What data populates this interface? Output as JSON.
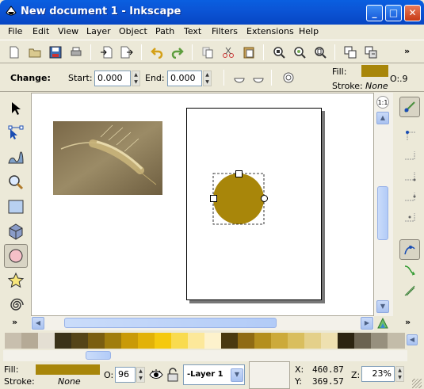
{
  "window": {
    "title": "New document 1 - Inkscape",
    "buttons": [
      "_",
      "□",
      "✕"
    ]
  },
  "menu": [
    "File",
    "Edit",
    "View",
    "Layer",
    "Object",
    "Path",
    "Text",
    "Filters",
    "Extensions",
    "Help"
  ],
  "toolbar": {
    "overflow": "»"
  },
  "controls": {
    "label": "Change:",
    "start_label": "Start:",
    "start_value": "0.000",
    "end_label": "End:",
    "end_value": "0.000"
  },
  "style_indicator": {
    "fill_label": "Fill:",
    "fill_color": "#A8860A",
    "opacity_label": "O:",
    "opacity_value": ".9",
    "stroke_label": "Stroke:",
    "stroke_value": "None"
  },
  "toolbox": {
    "overflow": "»"
  },
  "snapbar": {
    "overflow": "»"
  },
  "canvas": {
    "ellipse_color": "#A8860A"
  },
  "palette": {
    "colors": [
      "#C8BFAE",
      "#B5AA96",
      "#E4DFD3",
      "#3A3218",
      "#544417",
      "#7A5E10",
      "#A07D0C",
      "#C99A07",
      "#E2B208",
      "#F5C90E",
      "#F9DB4F",
      "#FCE89A",
      "#FDF2CC",
      "#4A3A10",
      "#8F6B14",
      "#B48F1E",
      "#CCAA3A",
      "#D9BE5E",
      "#E4D08A",
      "#EEE0B0",
      "#2C2410",
      "#6B6350",
      "#97907E",
      "#C3BCA9"
    ]
  },
  "status": {
    "fill_label": "Fill:",
    "fill_color": "#A8860A",
    "stroke_label": "Stroke:",
    "stroke_value": "None",
    "opacity_label": "O:",
    "opacity_value": "96",
    "layer": "-Layer 1",
    "x_label": "X:",
    "x_value": "460.87",
    "y_label": "Y:",
    "y_value": "369.57",
    "zoom_label": "Z:",
    "zoom_value": "23%"
  }
}
